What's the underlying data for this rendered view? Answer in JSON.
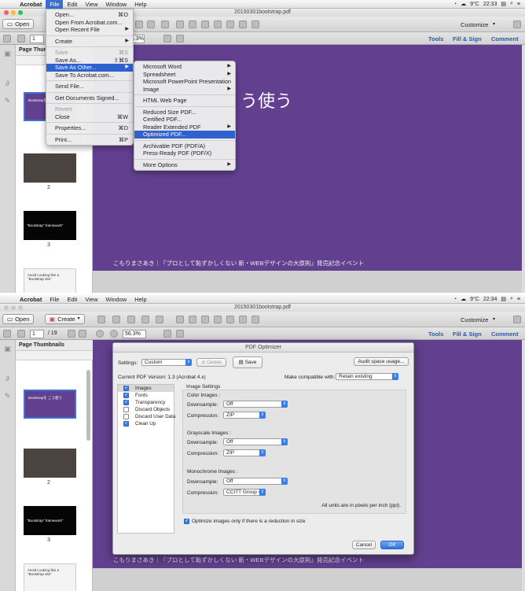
{
  "menubar": {
    "app": "Acrobat",
    "items": [
      "File",
      "Edit",
      "View",
      "Window",
      "Help"
    ],
    "time1": "22:33",
    "time2": "22:34",
    "temp": "9°C"
  },
  "window": {
    "title": "20150301bootstrap.pdf"
  },
  "toolbar": {
    "open": "Open",
    "create": "Create",
    "customize": "Customize",
    "page": "1",
    "total": "/ 19",
    "zoom": "56.3%",
    "tools": "Tools",
    "fill_sign": "Fill & Sign",
    "comment": "Comment"
  },
  "sidebar": {
    "title": "Page Thumbnails",
    "page_labels": [
      "2",
      "3"
    ]
  },
  "thumbs": [
    {
      "text": "Bootstrapを こう使う",
      "color": "#62408f"
    },
    {
      "text": "",
      "color": "#4a4340"
    },
    {
      "text": "\"Bootstrap\" framework\"",
      "color": "#050505"
    },
    {
      "text": "Avoid Looking like a \"Bootstrap site\"",
      "color": "#f4f4f4"
    }
  ],
  "slide": {
    "heading": "う使う",
    "footer": "こもりまさあき｜『プロとして恥ずかしくない 新・WEBデザインの大原則』発売記念イベント"
  },
  "file_menu": [
    {
      "label": "Open...",
      "shortcut": "⌘O"
    },
    {
      "label": "Open From Acrobat.com..."
    },
    {
      "label": "Open Recent File",
      "arrow": "▶"
    },
    {
      "divider": true
    },
    {
      "label": "Create",
      "arrow": "▶"
    },
    {
      "divider": true
    },
    {
      "label": "Save",
      "shortcut": "⌘S",
      "disabled": true
    },
    {
      "label": "Save As...",
      "shortcut": "⇧⌘S"
    },
    {
      "label": "Save As Other...",
      "arrow": "▶",
      "highlighted": true
    },
    {
      "label": "Save To Acrobat.com..."
    },
    {
      "divider": true
    },
    {
      "label": "Send File..."
    },
    {
      "divider": true
    },
    {
      "label": "Get Documents Signed..."
    },
    {
      "divider": true
    },
    {
      "label": "Revert",
      "disabled": true
    },
    {
      "label": "Close",
      "shortcut": "⌘W"
    },
    {
      "divider": true
    },
    {
      "label": "Properties...",
      "shortcut": "⌘D"
    },
    {
      "divider": true
    },
    {
      "label": "Print...",
      "shortcut": "⌘P"
    }
  ],
  "save_as_other_menu": [
    {
      "label": "Microsoft Word",
      "arrow": "▶"
    },
    {
      "label": "Spreadsheet",
      "arrow": "▶"
    },
    {
      "label": "Microsoft PowerPoint Presentation"
    },
    {
      "label": "Image",
      "arrow": "▶"
    },
    {
      "divider": true
    },
    {
      "label": "HTML Web Page"
    },
    {
      "divider": true
    },
    {
      "label": "Reduced Size PDF..."
    },
    {
      "label": "Certified PDF..."
    },
    {
      "label": "Reader Extended PDF",
      "arrow": "▶"
    },
    {
      "label": "Optimized PDF...",
      "highlighted": true
    },
    {
      "divider": true
    },
    {
      "label": "Archivable PDF (PDF/A)"
    },
    {
      "label": "Press-Ready PDF (PDF/X)"
    },
    {
      "divider": true
    },
    {
      "label": "More Options",
      "arrow": "▶"
    }
  ],
  "dialog": {
    "title": "PDF Optimizer",
    "settings_label": "Settings:",
    "settings_value": "Custom",
    "delete": "Delete",
    "save": "Save",
    "audit": "Audit space usage...",
    "version": "Current PDF Version: 1.3 (Acrobat 4.x)",
    "compat_label": "Make compatible with:",
    "compat_value": "Retain existing",
    "categories": [
      {
        "label": "Images",
        "checked": true
      },
      {
        "label": "Fonts",
        "checked": true
      },
      {
        "label": "Transparency",
        "checked": true
      },
      {
        "label": "Discard Objects",
        "checked": false
      },
      {
        "label": "Discard User Data",
        "checked": false
      },
      {
        "label": "Clean Up",
        "checked": true
      }
    ],
    "image_settings": "Image Settings",
    "color_images": "Color Images :",
    "grayscale_images": "Grayscale Images :",
    "monochrome_images": "Monochrome Images :",
    "downsample_label": "Downsample:",
    "compression_label": "Compression:",
    "off": "Off",
    "zip": "ZIP",
    "ccitt": "CCITT Group 4",
    "units_note": "All units are in pixels per inch (ppi).",
    "optimize_check": "Optimize images only if there is a reduction in size",
    "cancel": "Cancel",
    "ok": "OK"
  }
}
